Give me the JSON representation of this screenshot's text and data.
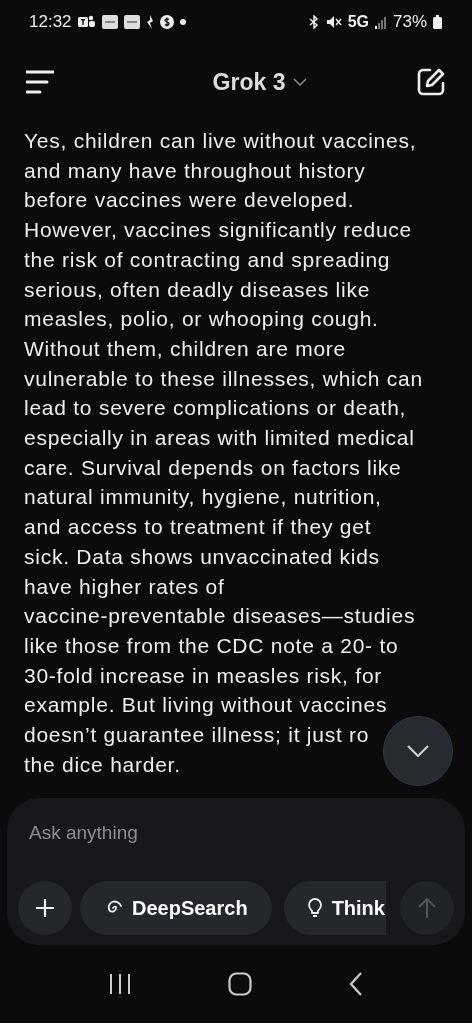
{
  "status_bar": {
    "time": "12:32",
    "network": "5G",
    "battery": "73%"
  },
  "header": {
    "title": "Grok 3"
  },
  "message": {
    "blocks": [
      [
        "Yes, children can live without vaccines,",
        "and many have throughout history",
        "before vaccines were developed.",
        "However, vaccines significantly reduce",
        "the risk of contracting and spreading",
        "serious, often deadly diseases like",
        "measles, polio, or whooping cough.",
        "Without them, children are more",
        "vulnerable to these illnesses, which can",
        "lead to severe complications or death,",
        "especially in areas with limited medical",
        "care. Survival depends on factors like",
        "natural immunity, hygiene, nutrition,",
        "and access to treatment if they get",
        "sick. Data shows unvaccinated kids",
        "have higher rates of",
        "vaccine-preventable diseases—studies",
        "like those from the CDC note a 20- to",
        "30-fold increase in measles risk, for",
        "example. But living without vaccines"
      ],
      [
        "doesn’t guarantee illness; it just ro",
        "the dice harder."
      ]
    ]
  },
  "composer": {
    "placeholder": "Ask anything",
    "buttons": [
      {
        "kind": "deepsearch",
        "label": "DeepSearch"
      },
      {
        "kind": "think",
        "label": "Think"
      }
    ],
    "send_disabled": true
  }
}
